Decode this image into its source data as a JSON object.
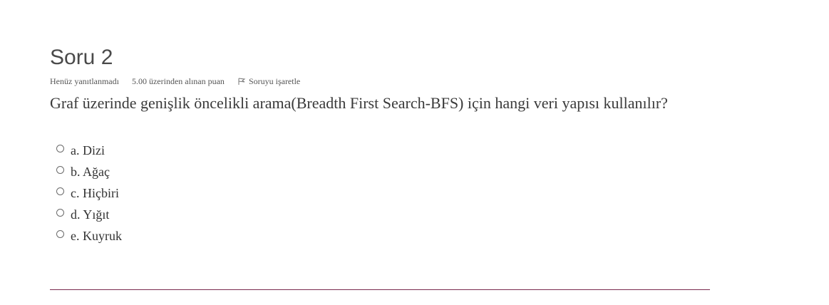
{
  "question": {
    "title": "Soru 2",
    "status": "Henüz yanıtlanmadı",
    "grade": "5.00 üzerinden alınan puan",
    "flag_label": "Soruyu işaretle",
    "text": "Graf üzerinde genişlik öncelikli arama(Breadth First Search-BFS) için hangi veri yapısı kullanılır?",
    "answers": [
      {
        "label": "a. Dizi"
      },
      {
        "label": "b. Ağaç"
      },
      {
        "label": "c. Hiçbiri"
      },
      {
        "label": "d. Yığıt"
      },
      {
        "label": "e. Kuyruk"
      }
    ]
  },
  "colors": {
    "divider": "#7a2a4e",
    "text": "#3a3a3a"
  }
}
